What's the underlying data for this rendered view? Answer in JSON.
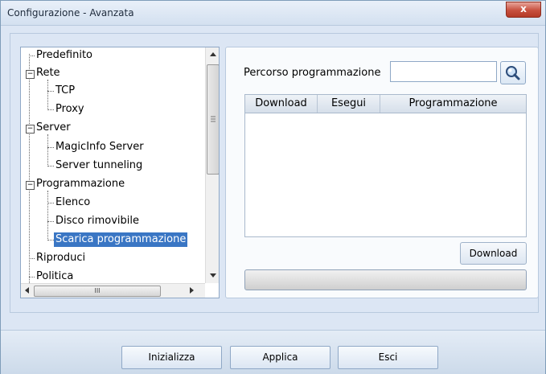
{
  "window": {
    "title": "Configurazione - Avanzata",
    "close_label": "x"
  },
  "tree": {
    "items": [
      {
        "label": "Predefinito"
      },
      {
        "label": "Rete",
        "expander": "−"
      },
      {
        "label": "TCP"
      },
      {
        "label": "Proxy"
      },
      {
        "label": "Server",
        "expander": "−"
      },
      {
        "label": "MagicInfo Server"
      },
      {
        "label": "Server tunneling"
      },
      {
        "label": "Programmazione",
        "expander": "−"
      },
      {
        "label": "Elenco"
      },
      {
        "label": "Disco rimovibile"
      },
      {
        "label": "Scarica programmazione",
        "selected": true
      },
      {
        "label": "Riproduci"
      },
      {
        "label": "Politica"
      }
    ],
    "hthumb_grip": "III"
  },
  "download_panel": {
    "path_label": "Percorso programmazione",
    "path_value": "",
    "columns": [
      "Download",
      "Esegui",
      "Programmazione"
    ],
    "download_button": "Download"
  },
  "footer": {
    "buttons": [
      "Inizializza",
      "Applica",
      "Esci"
    ]
  }
}
